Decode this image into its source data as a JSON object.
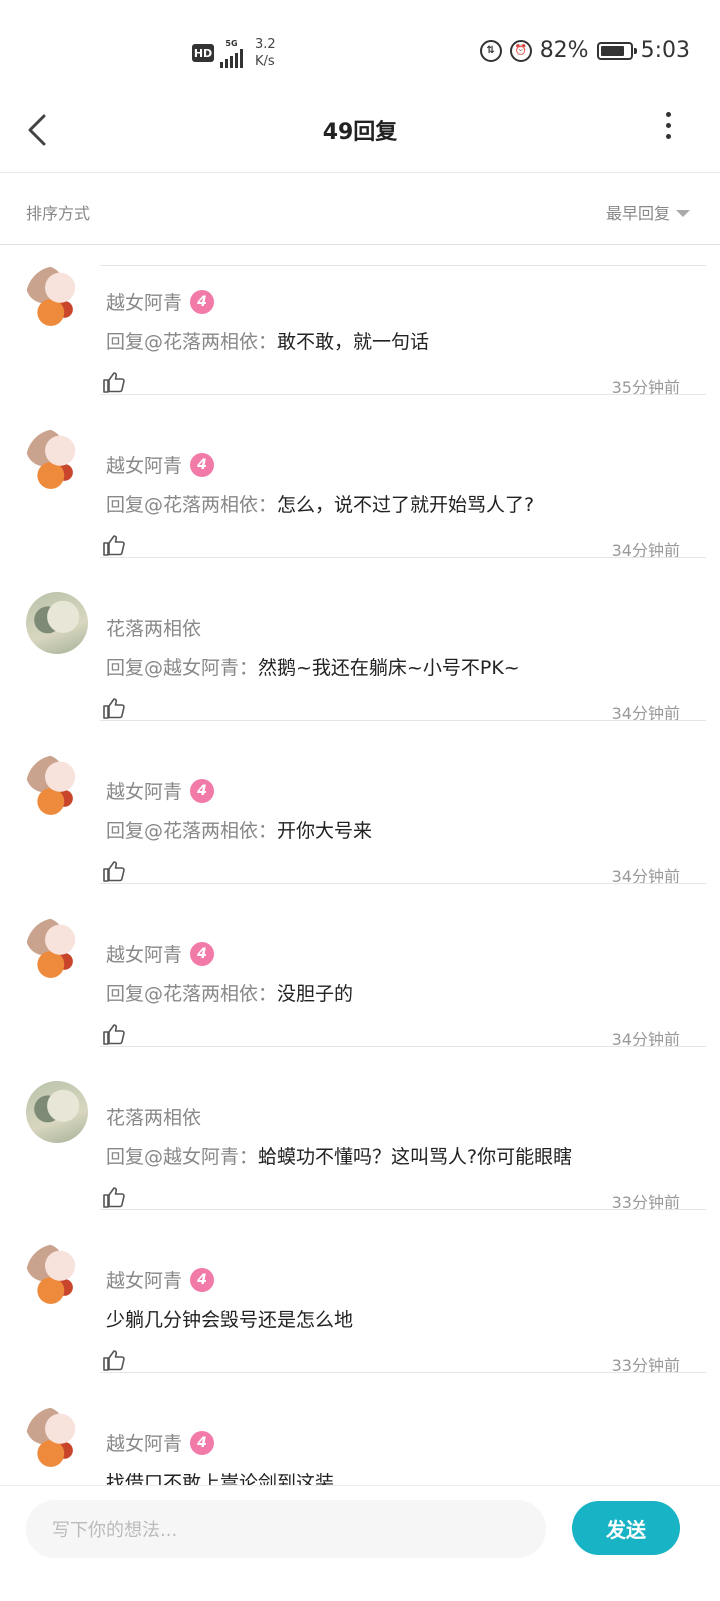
{
  "status_bar": {
    "hd": "HD",
    "network": "5G",
    "speed_value": "3.2",
    "speed_unit": "K/s",
    "battery": "82%",
    "battery_level": 0.82,
    "time": "5:03",
    "icons": [
      "data-saver-icon",
      "alarm-icon",
      "battery-icon"
    ]
  },
  "header": {
    "title": "49回复",
    "back_icon": "chevron-left-icon",
    "more_icon": "more-vertical-icon"
  },
  "sort": {
    "label": "排序方式",
    "value": "最早回复"
  },
  "comments": [
    {
      "user": "越女阿青",
      "level": "4",
      "prefix": "回复@花落两相依：",
      "text": "敢不敢，就一句话",
      "time": "35分钟前",
      "avatar": "a"
    },
    {
      "user": "越女阿青",
      "level": "4",
      "prefix": "回复@花落两相依：",
      "text": "怎么，说不过了就开始骂人了?",
      "time": "34分钟前",
      "avatar": "a"
    },
    {
      "user": "花落两相依",
      "level": "",
      "prefix": "回复@越女阿青：",
      "text": "然鹅~我还在躺床~小号不PK~",
      "time": "34分钟前",
      "avatar": "b"
    },
    {
      "user": "越女阿青",
      "level": "4",
      "prefix": "回复@花落两相依：",
      "text": "开你大号来",
      "time": "34分钟前",
      "avatar": "a"
    },
    {
      "user": "越女阿青",
      "level": "4",
      "prefix": "回复@花落两相依：",
      "text": "没胆子的",
      "time": "34分钟前",
      "avatar": "a"
    },
    {
      "user": "花落两相依",
      "level": "",
      "prefix": "回复@越女阿青：",
      "text": "蛤蟆功不懂吗？这叫骂人?你可能眼瞎",
      "time": "33分钟前",
      "avatar": "b"
    },
    {
      "user": "越女阿青",
      "level": "4",
      "prefix": "",
      "text": "少躺几分钟会毁号还是怎么地",
      "time": "33分钟前",
      "avatar": "a"
    },
    {
      "user": "越女阿青",
      "level": "4",
      "prefix": "",
      "text": "找借口不敢上嵩论剑到这装",
      "time": "",
      "avatar": "a"
    }
  ],
  "input": {
    "placeholder": "写下你的想法...",
    "send_label": "发送"
  },
  "colors": {
    "accent": "#18b3c4",
    "badge": "#f27aa8",
    "muted": "#888888"
  }
}
